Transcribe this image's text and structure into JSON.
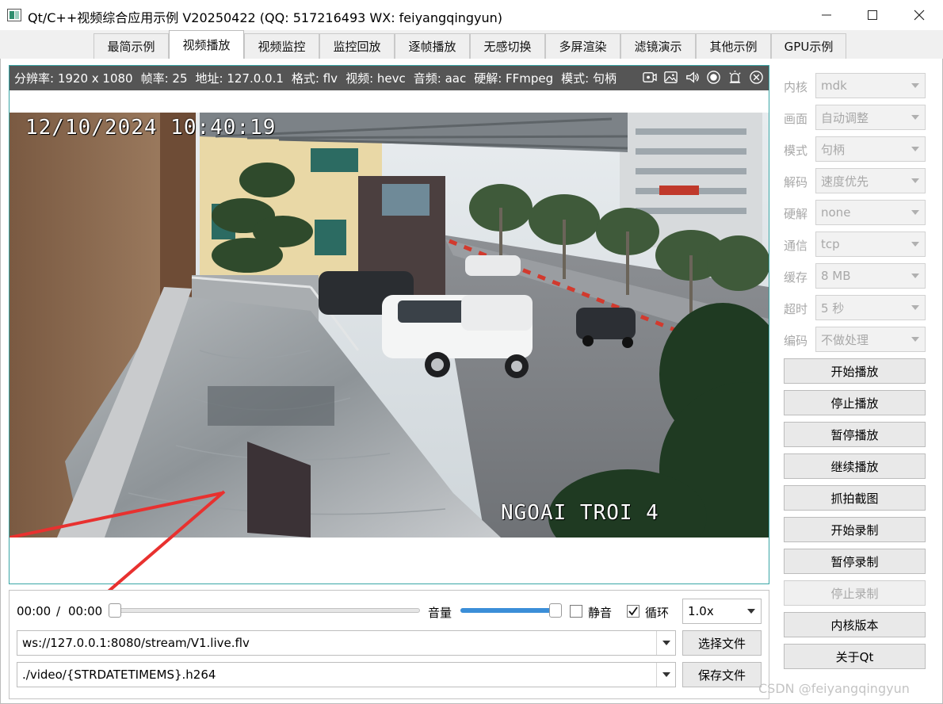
{
  "window": {
    "title": "Qt/C++视频综合应用示例 V20250422 (QQ: 517216493 WX: feiyangqingyun)"
  },
  "tabs": [
    {
      "label": "最简示例",
      "active": false
    },
    {
      "label": "视频播放",
      "active": true
    },
    {
      "label": "视频监控",
      "active": false
    },
    {
      "label": "监控回放",
      "active": false
    },
    {
      "label": "逐帧播放",
      "active": false
    },
    {
      "label": "无感切换",
      "active": false
    },
    {
      "label": "多屏渲染",
      "active": false
    },
    {
      "label": "滤镜演示",
      "active": false
    },
    {
      "label": "其他示例",
      "active": false
    },
    {
      "label": "GPU示例",
      "active": false
    }
  ],
  "info_bar": {
    "resolution": "分辨率: 1920 x 1080",
    "fps": "帧率: 25",
    "address": "地址: 127.0.0.1",
    "format": "格式: flv",
    "video": "视频: hevc",
    "audio": "音频: aac",
    "hwdecode": "硬解: FFmpeg",
    "mode": "模式: 句柄",
    "icons": [
      "record-icon",
      "snapshot-icon",
      "volume-icon",
      "stream-icon",
      "alarm-icon",
      "close-icon"
    ]
  },
  "video": {
    "osd_time": "12/10/2024 10:40:19",
    "osd_camera": "NGOAI TROI 4"
  },
  "controls": {
    "current_time": "00:00",
    "separator": "/",
    "total_time": "00:00",
    "progress": 0,
    "volume_label": "音量",
    "volume": 0.94,
    "mute_label": "静音",
    "mute_checked": false,
    "loop_label": "循环",
    "loop_checked": true,
    "speed": "1.0x",
    "url": "ws://127.0.0.1:8080/stream/V1.live.flv",
    "save_path": "./video/{STRDATETIMEMS}.h264",
    "select_file": "选择文件",
    "save_file": "保存文件"
  },
  "settings": [
    {
      "label": "内核",
      "value": "mdk"
    },
    {
      "label": "画面",
      "value": "自动调整"
    },
    {
      "label": "模式",
      "value": "句柄"
    },
    {
      "label": "解码",
      "value": "速度优先"
    },
    {
      "label": "硬解",
      "value": "none"
    },
    {
      "label": "通信",
      "value": "tcp"
    },
    {
      "label": "缓存",
      "value": "8 MB"
    },
    {
      "label": "超时",
      "value": "5 秒"
    },
    {
      "label": "编码",
      "value": "不做处理"
    }
  ],
  "actions": [
    {
      "label": "开始播放",
      "enabled": true
    },
    {
      "label": "停止播放",
      "enabled": true
    },
    {
      "label": "暂停播放",
      "enabled": true
    },
    {
      "label": "继续播放",
      "enabled": true
    },
    {
      "label": "抓拍截图",
      "enabled": true
    },
    {
      "label": "开始录制",
      "enabled": true
    },
    {
      "label": "暂停录制",
      "enabled": true
    },
    {
      "label": "停止录制",
      "enabled": false
    },
    {
      "label": "内核版本",
      "enabled": true
    },
    {
      "label": "关于Qt",
      "enabled": true
    }
  ],
  "watermark": "CSDN @feiyangqingyun",
  "colors": {
    "accent": "#3b8ed8",
    "frame_border": "#3aa6a6",
    "info_bar_bg": "#555555",
    "annotation_arrow": "#e8312f"
  }
}
